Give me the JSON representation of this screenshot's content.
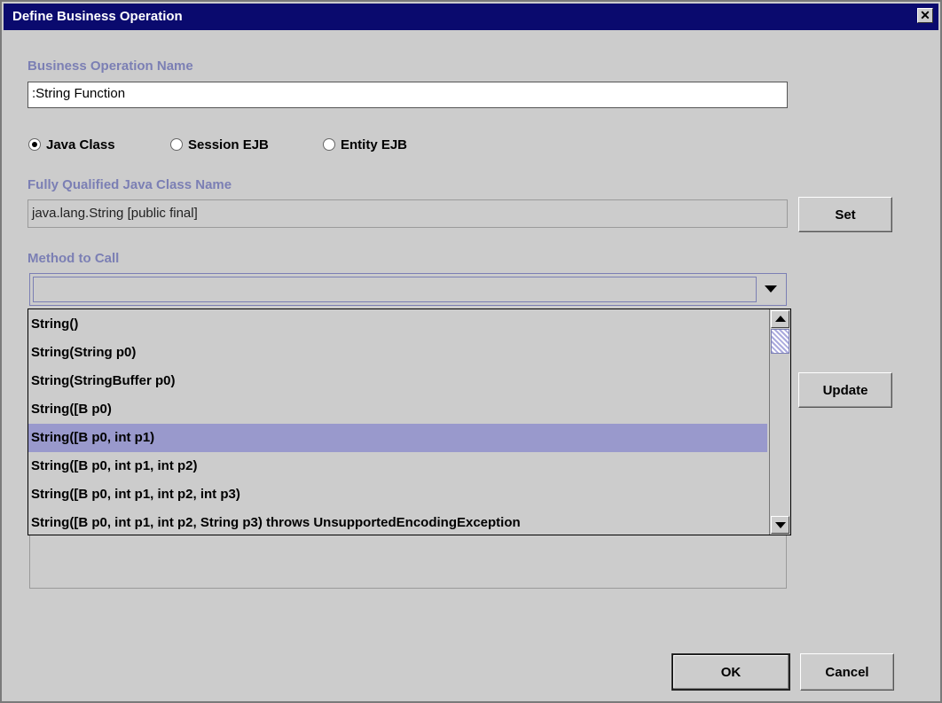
{
  "window": {
    "title": "Define Business Operation",
    "close_glyph": "✕"
  },
  "operation_name": {
    "label": "Business Operation Name",
    "value": ":String Function"
  },
  "class_type": {
    "options": [
      "Java Class",
      "Session EJB",
      "Entity EJB"
    ],
    "selected": "Java Class"
  },
  "class_name": {
    "label": "Fully Qualified Java Class Name",
    "value": "java.lang.String [public final]"
  },
  "buttons": {
    "set": "Set",
    "update": "Update",
    "ok": "OK",
    "cancel": "Cancel"
  },
  "method": {
    "label": "Method to Call",
    "value": "",
    "options": [
      "String()",
      "String(String p0)",
      "String(StringBuffer p0)",
      "String([B p0)",
      "String([B p0, int p1)",
      "String([B p0, int p1, int p2)",
      "String([B p0, int p1, int p2, int p3)",
      "String([B p0, int p1, int p2, String p3) throws UnsupportedEncodingException"
    ],
    "highlighted_index": 4
  },
  "colors": {
    "titlebar": "#0a0a6e",
    "label": "#7b7fb4",
    "selection": "#9999cc",
    "dialog_bg": "#cccccc"
  },
  "icons": {
    "close": "close-icon",
    "dropdown": "chevron-down-icon",
    "scroll_up": "arrow-up-icon",
    "scroll_down": "arrow-down-icon"
  }
}
